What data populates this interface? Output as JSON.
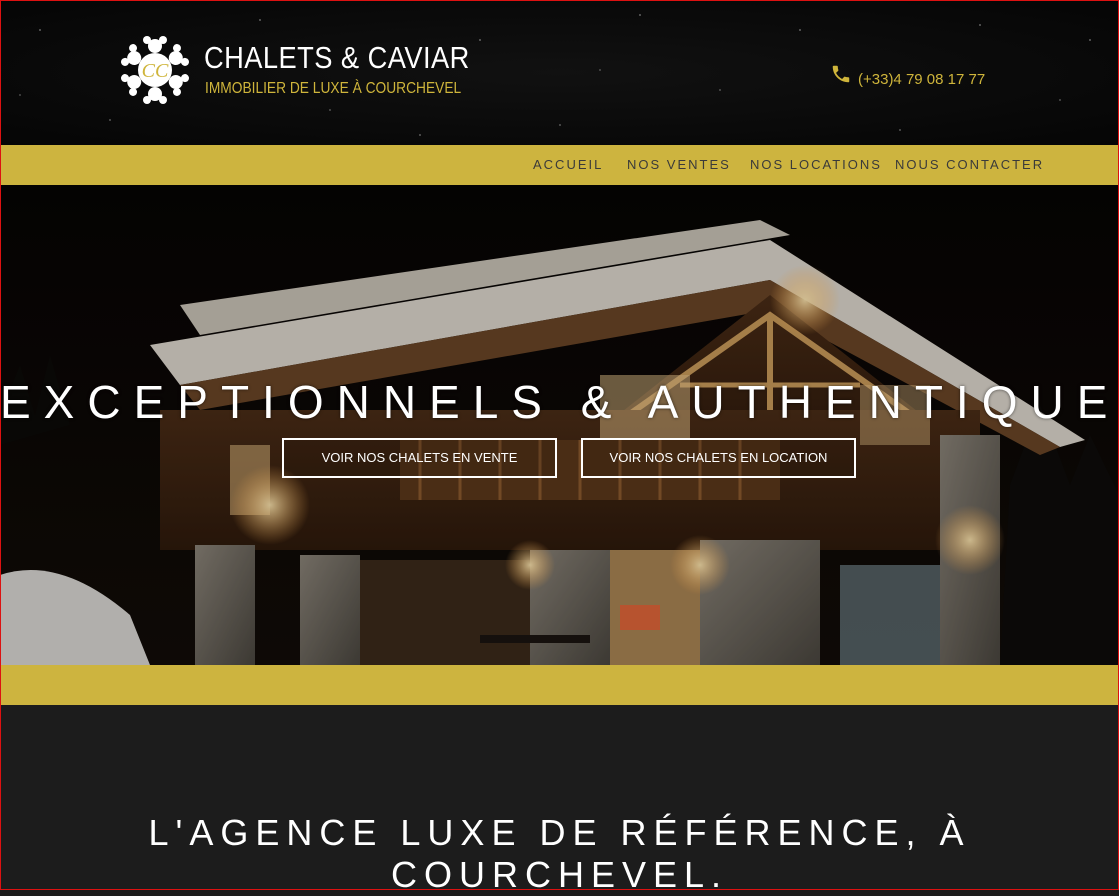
{
  "header": {
    "brand_name": "CHALETS & CAVIAR",
    "brand_tagline": "IMMOBILIER DE LUXE À COURCHEVEL",
    "phone": "(+33)4 79 08 17 77",
    "logo_icon": "snowflake-cc-logo",
    "phone_icon": "phone-icon"
  },
  "nav": {
    "items": [
      {
        "label": "ACCUEIL"
      },
      {
        "label": "NOS VENTES"
      },
      {
        "label": "NOS LOCATIONS"
      },
      {
        "label": "NOUS CONTACTER"
      }
    ]
  },
  "hero": {
    "title": "EXCEPTIONNELS & AUTHENTIQUES.",
    "buttons": [
      {
        "label": "VOIR NOS CHALETS EN VENTE"
      },
      {
        "label": "VOIR NOS CHALETS EN LOCATION"
      }
    ]
  },
  "section": {
    "tagline": "L'AGENCE LUXE DE RÉFÉRENCE, À COURCHEVEL."
  },
  "colors": {
    "gold": "#cdb43f",
    "dark": "#1c1c1c",
    "text": "#ffffff"
  }
}
